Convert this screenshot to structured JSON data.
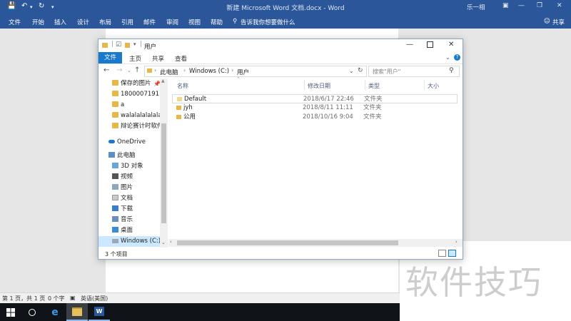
{
  "word": {
    "title": "新建 Microsoft Word 文档.docx - Word",
    "user": "乐一相",
    "ribbon_tabs": [
      "文件",
      "开始",
      "插入",
      "设计",
      "布局",
      "引用",
      "邮件",
      "审阅",
      "视图",
      "帮助"
    ],
    "tell_me": "告诉我你想要做什么",
    "share": "共享",
    "status": {
      "page": "第 1 页，共 1 页",
      "words": "0 个字",
      "lang": "英语(美国)"
    }
  },
  "explorer": {
    "title": "用户",
    "tabs": [
      "文件",
      "主页",
      "共享",
      "查看"
    ],
    "address": {
      "segments": [
        "此电脑",
        "Windows (C:)",
        "用户"
      ]
    },
    "search_placeholder": "搜索\"用户\"",
    "nav": [
      {
        "label": "保存的图片",
        "icon": "folder-icon",
        "pinned": true
      },
      {
        "label": "1800007191",
        "icon": "folder-icon"
      },
      {
        "label": "a",
        "icon": "folder-icon"
      },
      {
        "label": "walalalalalalala",
        "icon": "folder-icon"
      },
      {
        "label": "辩论赛计时软件",
        "icon": "folder-icon"
      },
      {
        "label": "OneDrive",
        "icon": "onedrive-icon"
      },
      {
        "label": "此电脑",
        "icon": "this-pc-icon"
      },
      {
        "label": "3D 对象",
        "icon": "3d-objects-icon"
      },
      {
        "label": "视频",
        "icon": "videos-icon"
      },
      {
        "label": "图片",
        "icon": "pictures-icon"
      },
      {
        "label": "文档",
        "icon": "documents-icon"
      },
      {
        "label": "下载",
        "icon": "downloads-icon"
      },
      {
        "label": "音乐",
        "icon": "music-icon"
      },
      {
        "label": "桌面",
        "icon": "desktop-icon"
      },
      {
        "label": "Windows (C:)",
        "icon": "drive-icon",
        "selected": true
      }
    ],
    "columns": [
      "名称",
      "修改日期",
      "类型",
      "大小"
    ],
    "rows": [
      {
        "name": "Default",
        "date": "2018/6/17 22:46",
        "type": "文件夹"
      },
      {
        "name": "jyh",
        "date": "2018/8/11 11:11",
        "type": "文件夹"
      },
      {
        "name": "公用",
        "date": "2018/10/16 9:04",
        "type": "文件夹"
      }
    ],
    "status": "3 个项目"
  },
  "watermark": "软件技巧",
  "colors": {
    "word_blue": "#2b579a",
    "explorer_accent": "#1979ca",
    "folder": "#e6b84a",
    "taskbar": "#101418"
  }
}
